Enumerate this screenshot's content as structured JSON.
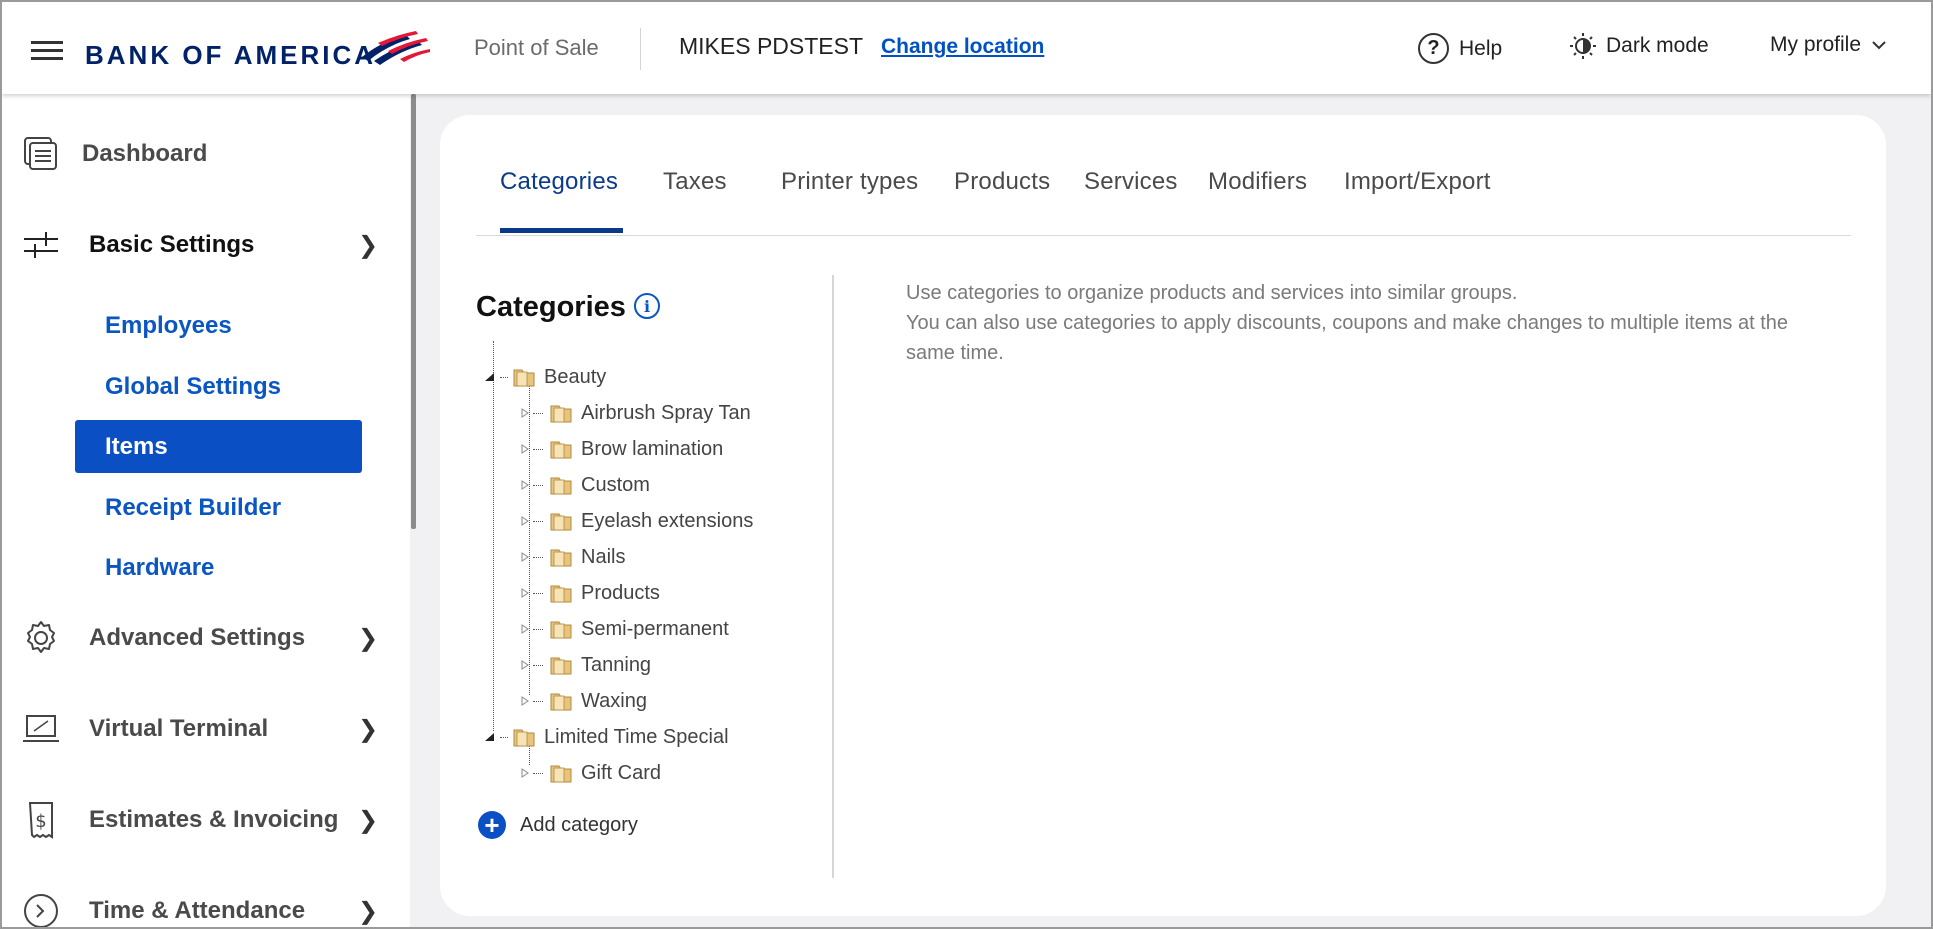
{
  "header": {
    "brand": "BANK OF AMERICA",
    "app_name": "Point of Sale",
    "location_name": "MIKES PDSTEST",
    "change_location": "Change location",
    "help": "Help",
    "dark_mode": "Dark mode",
    "profile": "My profile"
  },
  "sidebar": {
    "items": [
      {
        "label": "Dashboard",
        "icon": "dashboard-icon"
      },
      {
        "label": "Basic Settings",
        "icon": "sliders-icon",
        "expanded": true,
        "children": [
          "Employees",
          "Global Settings",
          "Items",
          "Receipt Builder",
          "Hardware"
        ],
        "active_child": "Items"
      },
      {
        "label": "Advanced Settings",
        "icon": "gear-icon"
      },
      {
        "label": "Virtual Terminal",
        "icon": "laptop-icon"
      },
      {
        "label": "Estimates & Invoicing",
        "icon": "invoice-icon"
      },
      {
        "label": "Time & Attendance",
        "icon": "clock-icon"
      }
    ]
  },
  "main": {
    "tabs": [
      "Categories",
      "Taxes",
      "Printer types",
      "Products",
      "Services",
      "Modifiers",
      "Import/Export"
    ],
    "active_tab": "Categories",
    "categories_title": "Categories",
    "tree": [
      {
        "label": "Beauty",
        "children": [
          "Airbrush Spray Tan",
          "Brow lamination",
          "Custom",
          "Eyelash extensions",
          "Nails",
          "Products",
          "Semi-permanent",
          "Tanning",
          "Waxing"
        ]
      },
      {
        "label": "Limited Time Special",
        "children": [
          "Gift Card"
        ]
      }
    ],
    "add_category": "Add category",
    "description_line1": "Use categories to organize products and services into similar groups.",
    "description_line2": "You can also use categories to apply discounts, coupons and make changes to multiple items at the same time."
  },
  "colors": {
    "brand_navy": "#012169",
    "brand_red": "#e31837",
    "link_blue": "#0a56c2",
    "active_item_bg": "#0a4fc3"
  }
}
